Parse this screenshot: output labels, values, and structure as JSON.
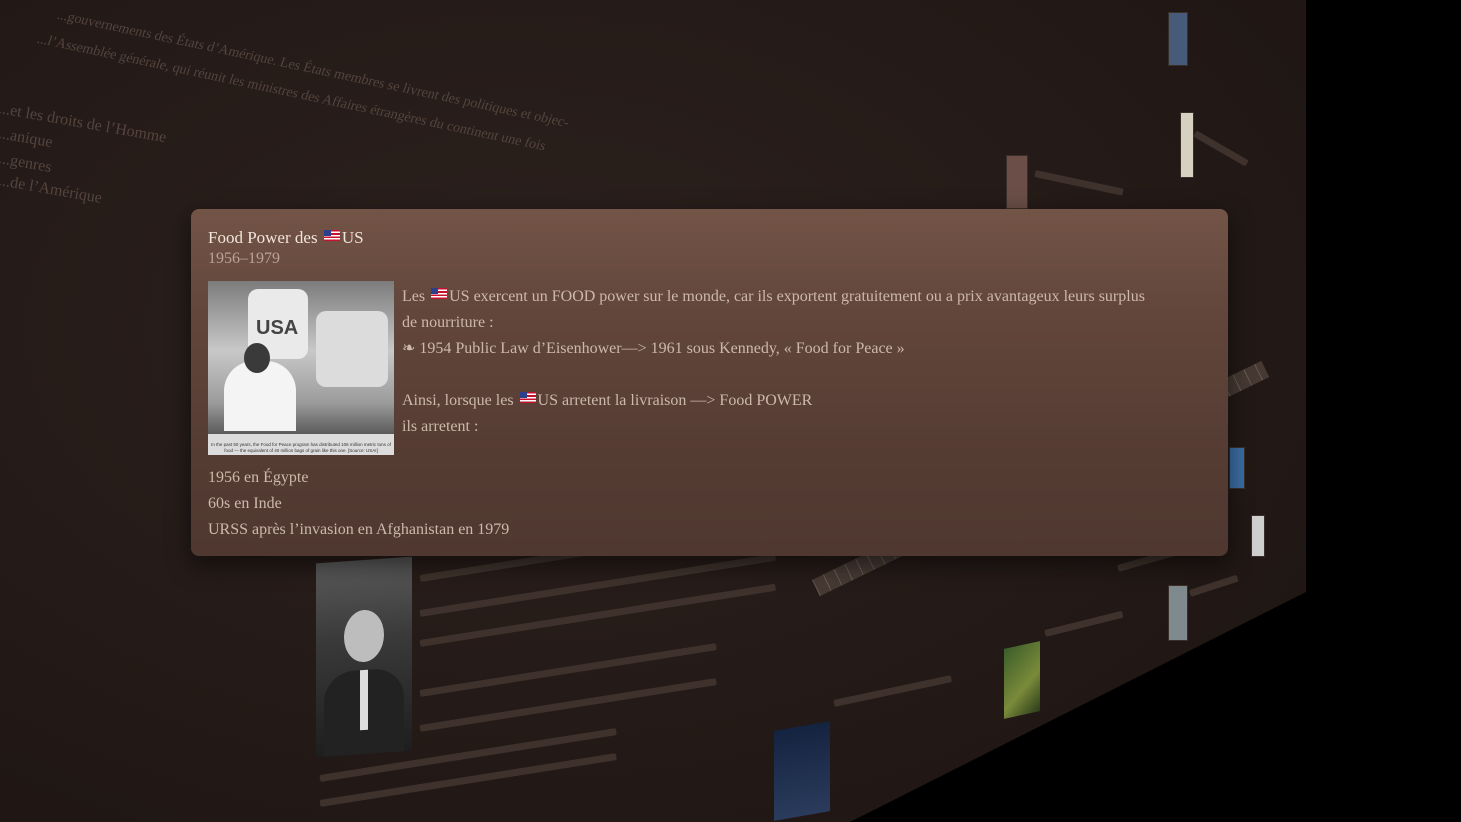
{
  "card": {
    "title_prefix": "Food Power des",
    "title_suffix": "US",
    "date_range": "1956–1979",
    "body": {
      "line1_prefix": "Les",
      "line1_suffix": "US  exercent un FOOD power sur le monde, car ils exportent gratuitement ou a prix avantageux leurs surplus",
      "line2": "de nourriture :",
      "line3": "❧ 1954 Public Law d’Eisenhower—>  1961 sous Kennedy, « Food for Peace »",
      "line4_prefix": "Ainsi, lorsque les",
      "line4_suffix": "US arretent la livraison —> Food POWER",
      "line5": "ils arretent :"
    },
    "list": [
      "1956 en Égypte",
      "60s en Inde",
      "URSS après l’invasion en Afghanistan en 1979"
    ],
    "photo": {
      "bag_label": "USA",
      "caption": "In the past 50 years, the Food for Peace program has distributed 106 million metric tons of food — the equivalent of 40 million bags of grain like this one. [Source: USAI]"
    },
    "flag_icon": "us-flag-icon"
  },
  "background": {
    "wall_text": [
      "...gouvernements des États d’Amérique. Les États membres se livrent des politiques et objec-",
      "...l’Assemblée générale, qui réunit les ministres des Affaires étrangères du continent une fois",
      "...et les droits de l’Homme",
      "...anique",
      "...genres",
      "...de l’Amérique"
    ]
  },
  "colors": {
    "card_top": "#735447",
    "card_bottom": "#4f3830",
    "wall": "#241a17",
    "text": "#cdb9ac"
  }
}
